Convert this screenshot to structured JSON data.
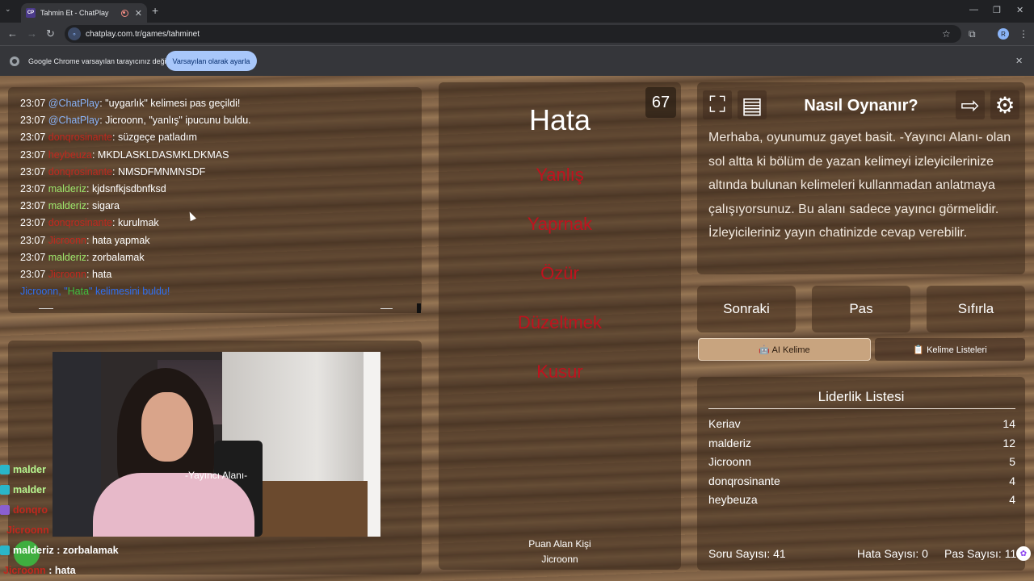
{
  "browser": {
    "tab_title": "Tahmin Et - ChatPlay",
    "tab_favicon": "CP",
    "url": "chatplay.com.tr/games/tahminet",
    "profile_initial": "R",
    "infobar_message": "Google Chrome varsayılan tarayıcınız değil",
    "infobar_button": "Varsayılan olarak ayarla"
  },
  "chat": {
    "lines": [
      {
        "time": "23:07",
        "nick": "@ChatPlay",
        "nick_color": "blue",
        "text": ": \"uygarlık\" kelimesi pas geçildi!"
      },
      {
        "time": "23:07",
        "nick": "@ChatPlay",
        "nick_color": "blue",
        "text": ": Jicroonn, \"yanlış\" ipucunu buldu."
      },
      {
        "time": "23:07",
        "nick": "donqrosinante",
        "nick_color": "red",
        "text": ": süzgeçe patladım"
      },
      {
        "time": "23:07",
        "nick": "heybeuza",
        "nick_color": "red",
        "text": ": MKDLASKLDASMKLDKMAS"
      },
      {
        "time": "23:07",
        "nick": "donqrosinante",
        "nick_color": "red",
        "text": ": NMSDFMNMNSDF"
      },
      {
        "time": "23:07",
        "nick": "malderiz",
        "nick_color": "green",
        "text": ": kjdsnfkjsdbnfksd"
      },
      {
        "time": "23:07",
        "nick": "malderiz",
        "nick_color": "green",
        "text": ": sigara"
      },
      {
        "time": "23:07",
        "nick": "donqrosinante",
        "nick_color": "red",
        "text": ": kurulmak"
      },
      {
        "time": "23:07",
        "nick": "Jicroonn",
        "nick_color": "red",
        "text": ": hata yapmak"
      },
      {
        "time": "23:07",
        "nick": "malderiz",
        "nick_color": "green",
        "text": ": zorbalamak"
      },
      {
        "time": "23:07",
        "nick": "Jicroonn",
        "nick_color": "red",
        "text": ": hata"
      }
    ],
    "system_pre": "Jicroonn, \"",
    "system_word": "Hata",
    "system_post": "\" kelimesini buldu!"
  },
  "overlay_chat": [
    {
      "nick": "malder",
      "color": "g",
      "text": ""
    },
    {
      "nick": "malder",
      "color": "g",
      "text": ""
    },
    {
      "nick": "donqro",
      "color": "r",
      "text": ""
    },
    {
      "nick": "Jicroonn",
      "color": "r",
      "text": ""
    },
    {
      "nick": "malderiz",
      "color": "w",
      "text": " : zorbalamak"
    },
    {
      "nick": "Jicroonn",
      "color": "r",
      "text": " : hata"
    }
  ],
  "streamer_label": "-Yayıncı Alanı-",
  "game": {
    "timer": "67",
    "word": "Hata",
    "taboo_words": [
      "Yanlış",
      "Yaprnak",
      "Özür",
      "Düzeltmek",
      "Kusur"
    ],
    "scorer_label": "Puan Alan Kişi",
    "scorer_name": "Jicroonn"
  },
  "howto": {
    "title": "Nasıl Oynanır?",
    "text": "Merhaba, oyunumuz gayet basit. -Yayıncı Alanı- olan sol altta ki bölüm de yazan kelimeyi izleyicilerinize altında bulunan kelimeleri kullanmadan anlatmaya çalışıyorsunuz. Bu alanı sadece yayıncı görmelidir. İzleyicileriniz yayın chatinizde cevap verebilir."
  },
  "actions": {
    "next": "Sonraki",
    "pass": "Pas",
    "reset": "Sıfırla",
    "ai_word": "🤖 AI Kelime",
    "word_lists": "📋 Kelime Listeleri"
  },
  "leaderboard": {
    "title": "Liderlik Listesi",
    "rows": [
      {
        "name": "Keriav",
        "score": "14"
      },
      {
        "name": "malderiz",
        "score": "12"
      },
      {
        "name": "Jicroonn",
        "score": "5"
      },
      {
        "name": "donqrosinante",
        "score": "4"
      },
      {
        "name": "heybeuza",
        "score": "4"
      }
    ]
  },
  "stats": {
    "questions": "Soru Sayısı: 41",
    "errors": "Hata Sayısı: 0",
    "passes": "Pas Sayısı: 11"
  },
  "colors": {
    "taboo": "#c0121e",
    "system_msg": "#2f6ff0",
    "nick_green": "#9ce66b",
    "nick_blue": "#8ab4f8"
  },
  "icons": [
    "fullscreen-icon",
    "rules-book-icon",
    "exit-icon",
    "settings-gear-icon"
  ]
}
